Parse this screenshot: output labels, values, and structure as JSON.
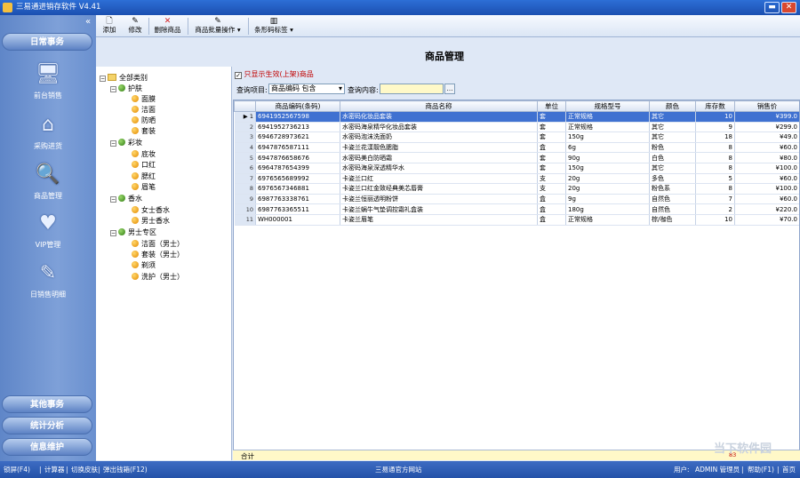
{
  "window": {
    "title": "三易通进销存软件 V4.41",
    "min": "▬",
    "close": "✕"
  },
  "sidebar": {
    "collapse": "«",
    "heading": "日常事务",
    "items": [
      {
        "label": "前台销售",
        "icon": "🖥"
      },
      {
        "label": "采购进货",
        "icon": "⌂"
      },
      {
        "label": "商品管理",
        "icon": "🔍"
      },
      {
        "label": "VIP管理",
        "icon": "♥"
      },
      {
        "label": "日销售明细",
        "icon": "✎"
      }
    ],
    "bottom_sections": [
      "其他事务",
      "统计分析",
      "信息维护"
    ]
  },
  "toolbar": {
    "items": [
      "添加",
      "修改",
      "删除商品",
      "商品批量操作",
      "条形码标签"
    ]
  },
  "page": {
    "title": "商品管理"
  },
  "filter": {
    "only_active_label": "只显示生效(上架)商品",
    "only_active_checked": true,
    "query_field_label": "查询项目:",
    "query_field_value": "商品编码 包含",
    "query_content_label": "查询内容:",
    "query_content_value": ""
  },
  "tree": {
    "root": "全部类别",
    "groups": [
      {
        "name": "护肤",
        "children": [
          "面膜",
          "洁面",
          "防晒",
          "套装"
        ]
      },
      {
        "name": "彩妆",
        "children": [
          "底妆",
          "口红",
          "腮红",
          "眉笔"
        ]
      },
      {
        "name": "香水",
        "children": [
          "女士香水",
          "男士香水"
        ]
      },
      {
        "name": "男士专区",
        "children": [
          "洁面（男士）",
          "套装（男士）",
          "剃须",
          "洗护（男士）"
        ]
      }
    ]
  },
  "grid": {
    "columns": [
      "商品编码(条码)",
      "商品名称",
      "单位",
      "规格型号",
      "颜色",
      "库存数",
      "销售价"
    ],
    "rows": [
      [
        "6941952567598",
        "水密码化妆品套装",
        "套",
        "正常规格",
        "其它",
        "10",
        "¥399.0"
      ],
      [
        "6941952736213",
        "水密码海泉精华化妆品套装",
        "套",
        "正常规格",
        "其它",
        "9",
        "¥299.0"
      ],
      [
        "6946728973621",
        "水密码泡沫洗面奶",
        "套",
        "150g",
        "其它",
        "18",
        "¥49.0"
      ],
      [
        "6947876587111",
        "卡姿兰花漾靓色腮脂",
        "盒",
        "6g",
        "粉色",
        "8",
        "¥60.0"
      ],
      [
        "6947876658676",
        "水密码美白防晒霜",
        "套",
        "90g",
        "白色",
        "8",
        "¥80.0"
      ],
      [
        "6964787654399",
        "水密码海泉深透精华水",
        "套",
        "150g",
        "其它",
        "8",
        "¥100.0"
      ],
      [
        "6976565689992",
        "卡姿兰口红",
        "支",
        "20g",
        "多色",
        "5",
        "¥60.0"
      ],
      [
        "6976567346881",
        "卡姿兰口红金致经典美芯唇膏",
        "支",
        "20g",
        "粉色系",
        "8",
        "¥100.0"
      ],
      [
        "6987763338761",
        "卡姿兰恒丽透明粉饼",
        "盒",
        "9g",
        "自然色",
        "7",
        "¥60.0"
      ],
      [
        "6987763365511",
        "卡姿兰蜗牛气垫调控霜礼盒装",
        "盒",
        "180g",
        "自然色",
        "2",
        "¥220.0"
      ],
      [
        "WH000001",
        "卡姿兰眉笔",
        "盒",
        "正常规格",
        "棕/咖色",
        "10",
        "¥70.0"
      ]
    ],
    "total_label": "合计",
    "total_stock": "83"
  },
  "status": {
    "left": [
      "锁屏(F4)",
      "计算器",
      "切换皮肤",
      "弹出钱箱(F12)"
    ],
    "center": "三易通官方网站",
    "user_label": "用户:",
    "user": "ADMIN 管理员",
    "right": [
      "帮助(F1)",
      "首页"
    ]
  },
  "watermark": "当下软件园"
}
